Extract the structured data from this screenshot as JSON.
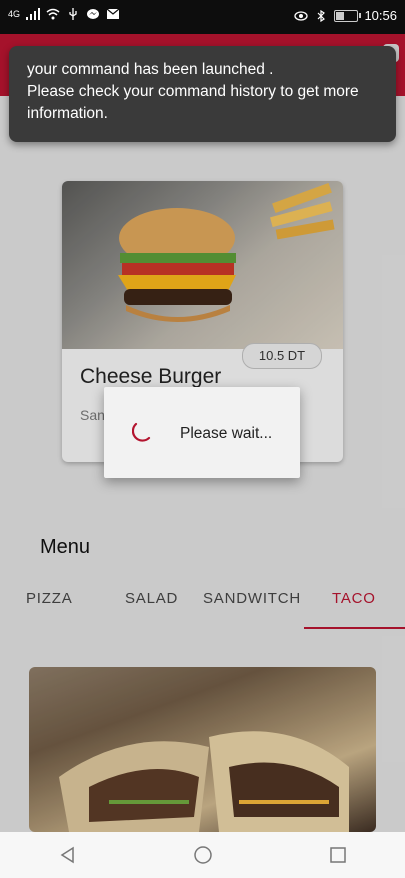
{
  "status_bar": {
    "network": "4G",
    "time": "10:56",
    "left_icons": [
      "signal-icon",
      "wifi-icon",
      "usb-icon",
      "messenger-icon",
      "mail-icon"
    ],
    "right_icons": [
      "eye-icon",
      "bluetooth-icon",
      "battery-icon"
    ]
  },
  "toast": {
    "line1": "your command has been launched .",
    "line2": "Please check your command history to get more information."
  },
  "featured_card": {
    "price": "10.5 DT",
    "title": "Cheese Burger",
    "subtitle": "San"
  },
  "dialog": {
    "message": "Please wait..."
  },
  "menu": {
    "title": "Menu",
    "tabs": [
      {
        "label": "PIZZA",
        "active": false
      },
      {
        "label": "SALAD",
        "active": false
      },
      {
        "label": "SANDWITCH",
        "active": false
      },
      {
        "label": "TACO",
        "active": true
      }
    ]
  },
  "colors": {
    "accent": "#b3142f",
    "toast_bg": "#3a3a3a",
    "dialog_bg": "#f2f2f2"
  }
}
